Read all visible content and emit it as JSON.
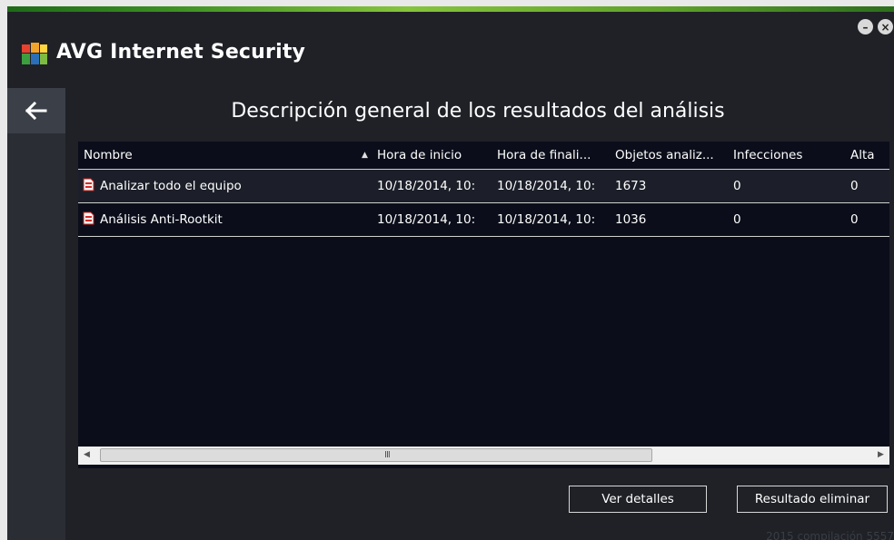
{
  "app": {
    "title_brand": "AVG",
    "title_product": "Internet Security"
  },
  "window_controls": {
    "minimize": "–",
    "close": "×"
  },
  "nav": {
    "back_icon": "arrow-left-icon"
  },
  "page_title": "Descripción general de los resultados del análisis",
  "table": {
    "columns": [
      "Nombre",
      "Hora de inicio",
      "Hora de finali...",
      "Objetos analiz...",
      "Infecciones",
      "Alta"
    ],
    "sort_indicator": "▲",
    "rows": [
      {
        "name": "Analizar todo el equipo",
        "start": "10/18/2014, 10:",
        "end": "10/18/2014, 10:",
        "objects": "1673",
        "infections": "0",
        "high": "0"
      },
      {
        "name": "Análisis Anti-Rootkit",
        "start": "10/18/2014, 10:",
        "end": "10/18/2014, 10:",
        "objects": "1036",
        "infections": "0",
        "high": "0"
      }
    ],
    "scrollbar": {
      "left_arrow": "◀",
      "right_arrow": "▶",
      "grip": "III"
    }
  },
  "buttons": {
    "details": "Ver detalles",
    "delete": "Resultado eliminar"
  },
  "footer": "2015  compilación 5557",
  "colors": {
    "background": "#1f2127",
    "table_bg": "#0b0e1a",
    "accent_green": "#86c43c",
    "text": "#ffffff"
  }
}
